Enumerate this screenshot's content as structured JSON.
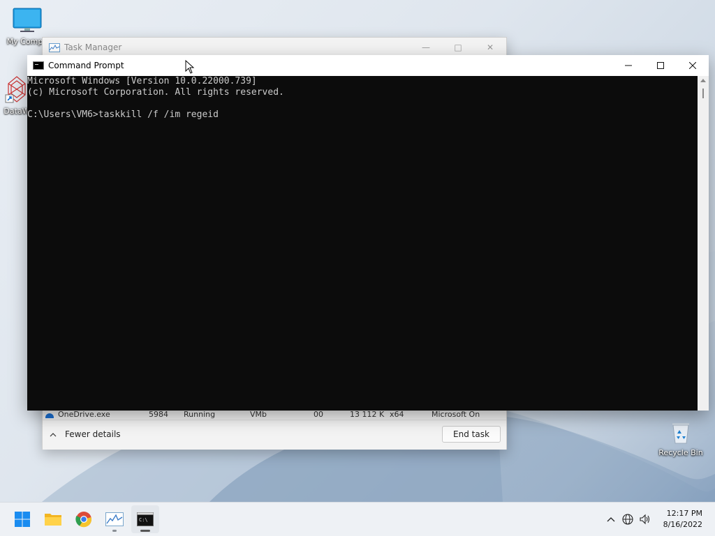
{
  "desktop": {
    "icons": [
      {
        "label": "My Compu",
        "icon": "computer-icon"
      },
      {
        "label": "DataW",
        "icon": "datawarrior-shortcut-icon"
      },
      {
        "label": "Recycle Bin",
        "icon": "recycle-bin-icon"
      }
    ]
  },
  "task_manager": {
    "title": "Task Manager",
    "partial_row": {
      "name": "OneDrive.exe",
      "pid": "5984",
      "status": "Running",
      "user": "VMb",
      "cpu": "00",
      "memory": "13 112 K",
      "arch": "x64",
      "description": "Microsoft On"
    },
    "fewer_details_label": "Fewer details",
    "end_task_label": "End task"
  },
  "command_prompt": {
    "title": "Command Prompt",
    "lines": [
      "Microsoft Windows [Version 10.0.22000.739]",
      "(c) Microsoft Corporation. All rights reserved.",
      "",
      "C:\\Users\\VM6>taskkill /f /im regeid"
    ]
  },
  "taskbar": {
    "apps": [
      {
        "name": "start",
        "icon": "windows-start-icon"
      },
      {
        "name": "file-explorer",
        "icon": "folder-icon"
      },
      {
        "name": "chrome",
        "icon": "chrome-icon"
      },
      {
        "name": "task-manager",
        "icon": "task-manager-icon"
      },
      {
        "name": "command-prompt",
        "icon": "cmd-icon"
      }
    ],
    "clock": {
      "time": "12:17 PM",
      "date": "8/16/2022"
    }
  }
}
